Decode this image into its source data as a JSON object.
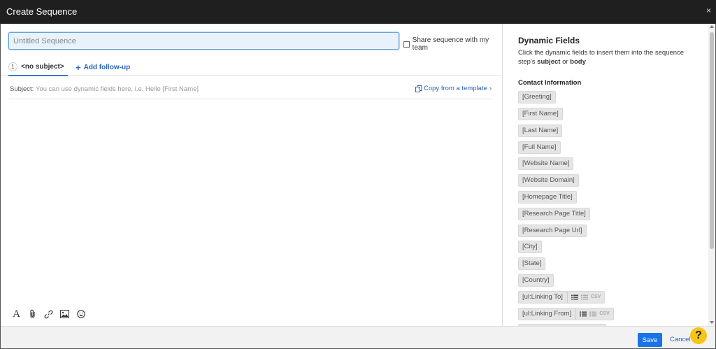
{
  "window": {
    "title": "Create Sequence",
    "close_label": "×"
  },
  "sequence_name": {
    "placeholder": "Untitled Sequence",
    "value": ""
  },
  "share_label": "Share sequence with my team",
  "tabs": [
    {
      "number": "1",
      "label": "<no subject>"
    },
    {
      "icon": "+",
      "label": "Add follow-up"
    }
  ],
  "subject": {
    "label": "Subject:",
    "placeholder": "You can use dynamic fields here, i.e. Hello [First Name]",
    "copy_label": "Copy from a template",
    "copy_chevron": "›"
  },
  "editor_toolbar": {
    "font_glyph": "A",
    "icons": [
      "font-icon",
      "attachment-icon",
      "link-icon",
      "image-icon",
      "emoji-icon"
    ]
  },
  "panel": {
    "title": "Dynamic Fields",
    "desc_pre": "Click the dynamic fields to insert them into the sequence step's ",
    "desc_b1": "subject",
    "desc_mid": " or ",
    "desc_b2": "body",
    "section": "Contact Information",
    "fields": [
      "[Greeting]",
      "[First Name]",
      "[Last Name]",
      "[Full Name]",
      "[Website Name]",
      "[Website Domain]",
      "[Homepage Title]",
      "[Research Page Title]",
      "[Research Page Url]",
      "[City]",
      "[State]",
      "[Country]",
      "[ul:Linking To]",
      "[ul:Linking From]"
    ],
    "list_field_csv": "CSV"
  },
  "footer": {
    "save_label": "Save",
    "cancel_label": "Cancel"
  },
  "help": {
    "label": "?",
    "color": "#f5c518"
  },
  "colors": {
    "accent": "#1b73e8",
    "link": "#2962b4",
    "titlebar": "#1f1f1f"
  }
}
